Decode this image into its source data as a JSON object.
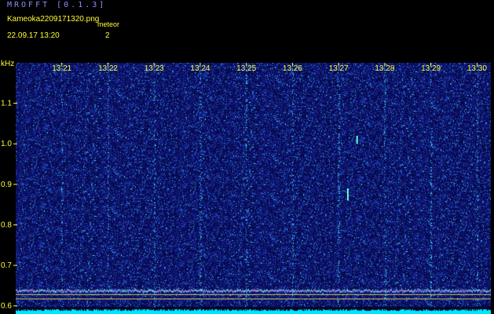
{
  "header": {
    "app_title": "MROFFT [0.1.3]",
    "file_name": "Kameoka2209171320.png",
    "meteor_label": "meteor",
    "timestamp": "22.09.17 13:20",
    "meteor_count": "2"
  },
  "chart_data": {
    "type": "heatmap",
    "title": "",
    "xlabel": "",
    "ylabel": "kHz",
    "x_ticks": [
      "13:21",
      "13:22",
      "13:23",
      "13:24",
      "13:25",
      "13:26",
      "13:27",
      "13:28",
      "13:29",
      "13:30"
    ],
    "x_range_minutes": [
      0,
      10.3
    ],
    "x_tick_minutes": [
      1,
      2,
      3,
      4,
      5,
      6,
      7,
      8,
      9,
      10
    ],
    "y_ticks": [
      "1.1",
      "1.0",
      "0.9",
      "0.8",
      "0.7",
      "0.6"
    ],
    "y_tick_values": [
      1.1,
      1.0,
      0.9,
      0.8,
      0.7,
      0.6
    ],
    "y_range": [
      0.58,
      1.2
    ],
    "grid": false,
    "carrier_frequency": 0.637,
    "meteor_events": [
      {
        "minute": 7.2,
        "freq_low": 0.86,
        "freq_high": 0.89
      },
      {
        "minute": 7.4,
        "freq_low": 1.0,
        "freq_high": 1.02
      }
    ],
    "colors": {
      "background": "#000000",
      "noise_low": "#0a0a5a",
      "noise_mid": "#2233cc",
      "noise_high": "#00ffff",
      "labels": "#ffff33",
      "title": "#8c8cff",
      "baseline": "#00e5ff"
    }
  }
}
